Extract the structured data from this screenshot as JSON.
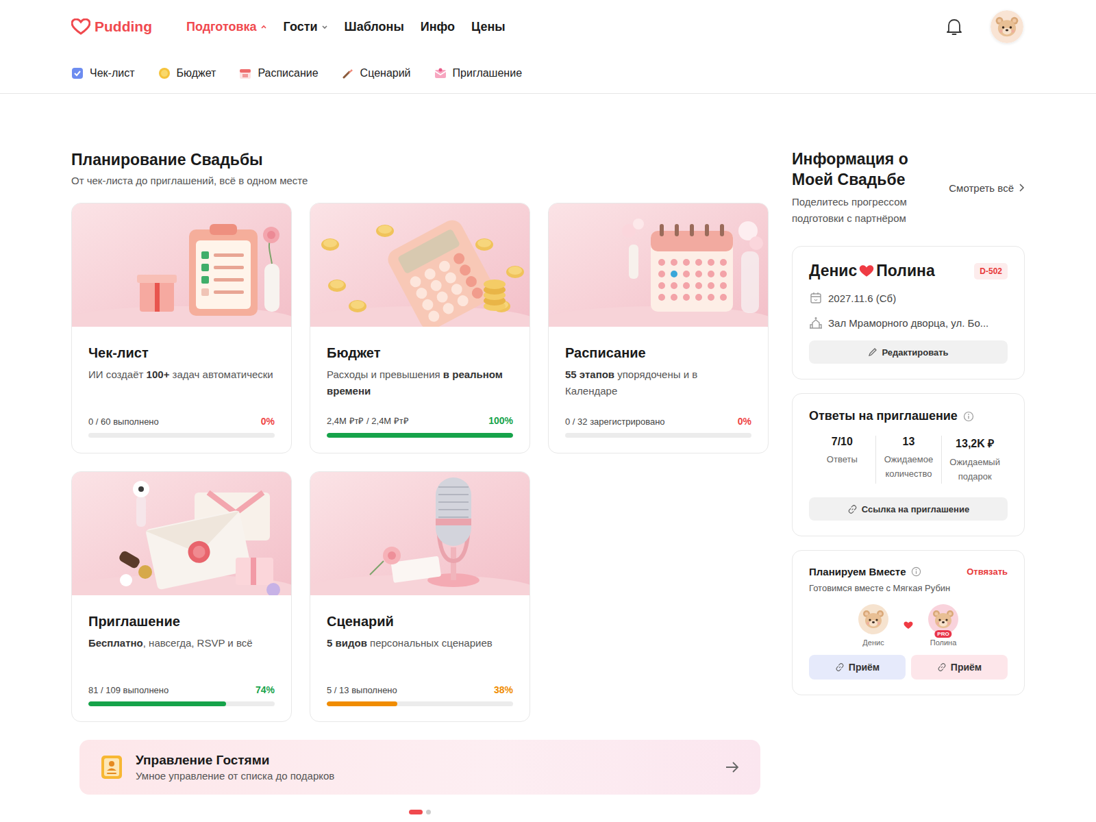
{
  "header": {
    "logo": "Pudding",
    "nav": [
      {
        "label": "Подготовка",
        "selected": true,
        "dropdown": true,
        "expanded": true
      },
      {
        "label": "Гости",
        "selected": false,
        "dropdown": true,
        "expanded": false
      },
      {
        "label": "Шаблоны",
        "selected": false,
        "dropdown": false,
        "expanded": false
      },
      {
        "label": "Инфо",
        "selected": false,
        "dropdown": false,
        "expanded": false
      },
      {
        "label": "Цены",
        "selected": false,
        "dropdown": false,
        "expanded": false
      }
    ]
  },
  "subnav": [
    {
      "label": "Чек-лист",
      "kind": "checklist"
    },
    {
      "label": "Бюджет",
      "kind": "budget"
    },
    {
      "label": "Расписание",
      "kind": "schedule"
    },
    {
      "label": "Сценарий",
      "kind": "scenario"
    },
    {
      "label": "Приглашение",
      "kind": "invitation"
    }
  ],
  "planning": {
    "title": "Планирование Свадьбы",
    "subtitle": "От чек-листа до приглашений, всё в одном месте",
    "cards": [
      {
        "kind": "checklist",
        "title": "Чек-лист",
        "description": [
          {
            "text": "ИИ создаёт ",
            "bold": false
          },
          {
            "text": "100+",
            "bold": true
          },
          {
            "text": " задач автоматически",
            "bold": false
          }
        ],
        "progress": "0 / 60 выполнено",
        "percent": "0%",
        "level": 0,
        "color": "#ef4444"
      },
      {
        "kind": "budget",
        "title": "Бюджет",
        "description": [
          {
            "text": "Расходы и превышения ",
            "bold": false
          },
          {
            "text": "в реальном времени",
            "bold": true
          }
        ],
        "progress": "2,4M ₽т₽ / 2,4M ₽т₽",
        "percent": "100%",
        "level": 1,
        "color": "#16a34a"
      },
      {
        "kind": "schedule",
        "title": "Расписание",
        "description": [
          {
            "text": "55 этапов",
            "bold": true
          },
          {
            "text": " упорядочены и в Календаре",
            "bold": false
          }
        ],
        "progress": "0 / 32 зарегистрировано",
        "percent": "0%",
        "level": 0,
        "color": "#ef4444"
      },
      {
        "kind": "invitation",
        "title": "Приглашение",
        "description": [
          {
            "text": "Бесплатно",
            "bold": true
          },
          {
            "text": ", навсегда, RSVP и всё",
            "bold": false
          }
        ],
        "progress": "81 / 109 выполнено",
        "percent": "74%",
        "level": 0.74,
        "color": "#16a34a"
      },
      {
        "kind": "scenario",
        "title": "Сценарий",
        "description": [
          {
            "text": "5 видов",
            "bold": true
          },
          {
            "text": " персональных сценариев",
            "bold": false
          }
        ],
        "progress": "5 / 13 выполнено",
        "percent": "38%",
        "level": 0.38,
        "color": "#f08c00"
      }
    ]
  },
  "guests_banner": {
    "title": "Управление Гостями",
    "subtitle": "Умное управление от списка до подарков"
  },
  "pagination": [
    {
      "selected": true
    },
    {
      "selected": false
    }
  ],
  "info": {
    "title": "Информация о Моей Свадьбе",
    "subtitle": "Поделитесь прогрессом подготовки с партнёром",
    "view_all": "Смотреть всё",
    "wedding": {
      "groom": "Денис",
      "bride": "Полина",
      "badge": "D-502",
      "date": "2027.11.6 (Сб)",
      "venue": "Зал Мраморного дворца, ул. Бо...",
      "button": "Редактировать"
    },
    "rsvp": {
      "title": "Ответы на приглашение",
      "stats": [
        {
          "value": "7/10",
          "label": "Ответы"
        },
        {
          "value": "13",
          "label": "Ожидаемое количество"
        },
        {
          "value": "13,2K ₽",
          "label": "Ожидаемый подарок"
        }
      ],
      "button": "Ссылка на приглашение"
    },
    "together": {
      "title": "Планируем Вместе",
      "unlink": "Отвязать",
      "subtitle": "Готовимся вместе с Мягкая Рубин",
      "partners": [
        {
          "name": "Денис",
          "pro": false,
          "badge": "",
          "color": "#f6e3cf"
        },
        {
          "name": "Полина",
          "pro": true,
          "badge": "PRO",
          "color": "#f9d3dc"
        }
      ],
      "buttons": [
        {
          "label": "Приём",
          "color": "#e6eafb"
        },
        {
          "label": "Приём",
          "color": "#fde6ea"
        }
      ]
    }
  }
}
